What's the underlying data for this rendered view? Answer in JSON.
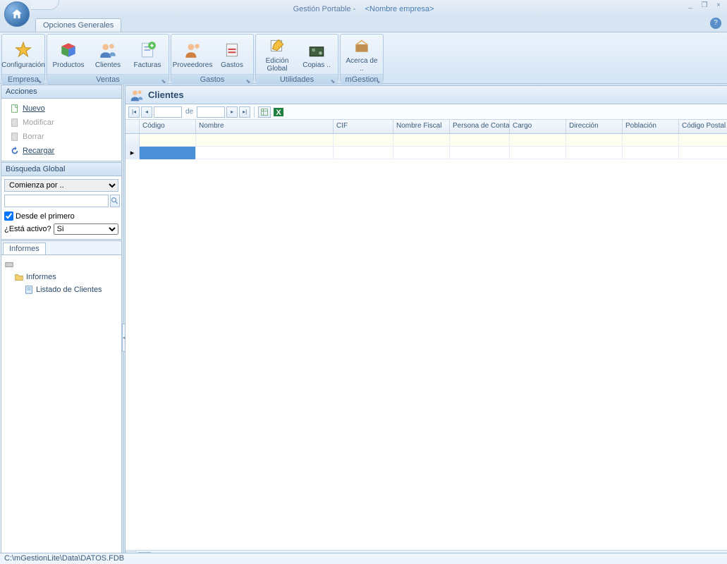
{
  "title": {
    "app": "Gestión Portable -",
    "company": "<Nombre empresa>"
  },
  "window_controls": {
    "min": "_",
    "restore": "❐",
    "close": "×"
  },
  "tabs": {
    "main": "Opciones Generales"
  },
  "ribbon": {
    "groups": [
      {
        "label": "Empresa",
        "buttons": [
          {
            "label": "Configuración",
            "icon": "star"
          }
        ]
      },
      {
        "label": "Ventas",
        "buttons": [
          {
            "label": "Productos",
            "icon": "products"
          },
          {
            "label": "Clientes",
            "icon": "clients"
          },
          {
            "label": "Facturas",
            "icon": "invoices"
          }
        ]
      },
      {
        "label": "Gastos",
        "buttons": [
          {
            "label": "Proveedores",
            "icon": "suppliers"
          },
          {
            "label": "Gastos",
            "icon": "expenses"
          }
        ]
      },
      {
        "label": "Utilidades",
        "buttons": [
          {
            "label": "Edición Global",
            "icon": "global-edit"
          },
          {
            "label": "Copias ..",
            "icon": "backup"
          }
        ]
      },
      {
        "label": "mGestion",
        "buttons": [
          {
            "label": "Acerca de ..",
            "icon": "about"
          }
        ]
      }
    ]
  },
  "sidebar": {
    "acciones": {
      "title": "Acciones",
      "items": [
        {
          "label": "Nuevo",
          "enabled": true
        },
        {
          "label": "Modificar",
          "enabled": false
        },
        {
          "label": "Borrar",
          "enabled": false
        },
        {
          "label": "Recargar",
          "enabled": true
        }
      ]
    },
    "busqueda": {
      "title": "Búsqueda Global",
      "mode_value": "Comienza por ..",
      "input_value": "",
      "primero_label": "Desde el primero",
      "primero_checked": true,
      "activo_label": "¿Está activo?",
      "activo_value": "Si"
    },
    "informes": {
      "tab": "Informes",
      "folder": "Informes",
      "report": "Listado de Clientes"
    }
  },
  "content": {
    "title": "Clientes",
    "pager": {
      "page": "",
      "of_label": "de",
      "total": ""
    },
    "columns": [
      "Código",
      "Nombre",
      "CIF",
      "Nombre Fiscal",
      "Persona de Contacto",
      "Cargo",
      "Dirección",
      "Población",
      "Código Postal"
    ]
  },
  "statusbar": {
    "path": "C:\\mGestionLite\\Data\\DATOS.FDB"
  }
}
